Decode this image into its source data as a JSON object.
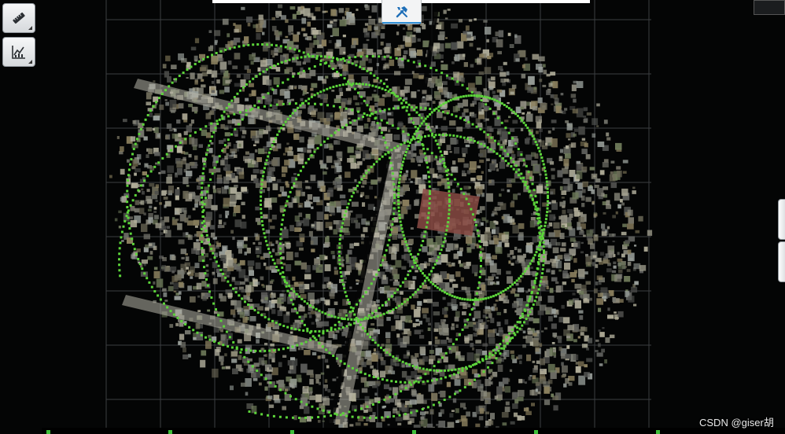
{
  "viewer": {
    "background_color": "#040505",
    "grid_color": "#4a4d50",
    "track_color": "#5cd43a",
    "point_palette": [
      "#5e5f5c",
      "#77786f",
      "#8e8d80",
      "#a9a795",
      "#6d6a58",
      "#8a7f5e",
      "#b5b19c",
      "#4c4d4a",
      "#9aa09b",
      "#6e7a5a"
    ],
    "roof_color": "#8a4b44",
    "visible_points": true,
    "visible_trajectory": true
  },
  "toolbar_left": {
    "items": [
      {
        "icon": "ruler-icon",
        "name": "measure-tool-button"
      },
      {
        "icon": "chart-icon",
        "name": "profile-chart-button"
      }
    ]
  },
  "top_toolbar": {
    "tab_icon": "tools-icon",
    "search_value": ""
  },
  "watermark": {
    "text": "CSDN @giser胡"
  }
}
